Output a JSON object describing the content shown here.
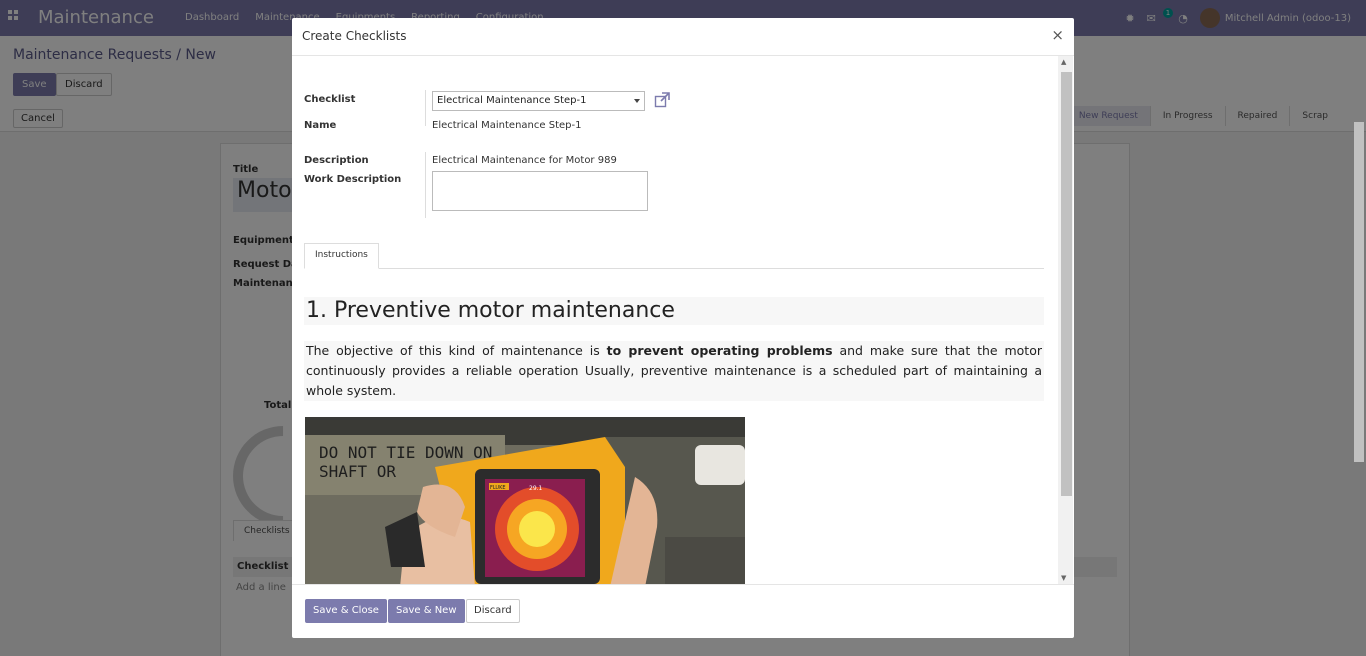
{
  "nav": {
    "brand": "Maintenance",
    "menu": [
      "Dashboard",
      "Maintenance",
      "Equipments",
      "Reporting",
      "Configuration"
    ],
    "chat_count": "1",
    "user": "Mitchell Admin (odoo-13)"
  },
  "control": {
    "breadcrumb": "Maintenance Requests / New",
    "save": "Save",
    "discard": "Discard",
    "cancel": "Cancel",
    "stages": [
      "New Request",
      "In Progress",
      "Repaired",
      "Scrap"
    ]
  },
  "form": {
    "title_label": "Title",
    "title_value": "Motor",
    "equipment_label": "Equipment",
    "request_date_label": "Request Dat",
    "maintenance_label": "Maintenance",
    "total_label": "Total C",
    "tab_checklists": "Checklists",
    "grid_header": "Checklist",
    "add_line": "Add a line"
  },
  "modal": {
    "title": "Create Checklists",
    "close": "×",
    "checklist_label": "Checklist",
    "checklist_value": "Electrical Maintenance Step-1",
    "name_label": "Name",
    "name_value": "Electrical Maintenance Step-1",
    "description_label": "Description",
    "description_value": "Electrical Maintenance for Motor 989",
    "work_description_label": "Work Description",
    "tab_instructions": "Instructions",
    "heading": "1. Preventive motor maintenance",
    "para_before": "The objective of this kind of maintenance is ",
    "para_bold": "to prevent operating problems",
    "para_after": " and make sure that the motor continuously provides a reliable operation Usually, preventive maintenance is a scheduled part of maintaining a whole system.",
    "photo_sign_line1": "DO NOT TIE DOWN ON",
    "photo_sign_line2": "SHAFT OR",
    "photo_reading": "29.1",
    "photo_brand": "FLUKE"
  },
  "footer": {
    "save_close": "Save & Close",
    "save_new": "Save & New",
    "discard": "Discard"
  }
}
